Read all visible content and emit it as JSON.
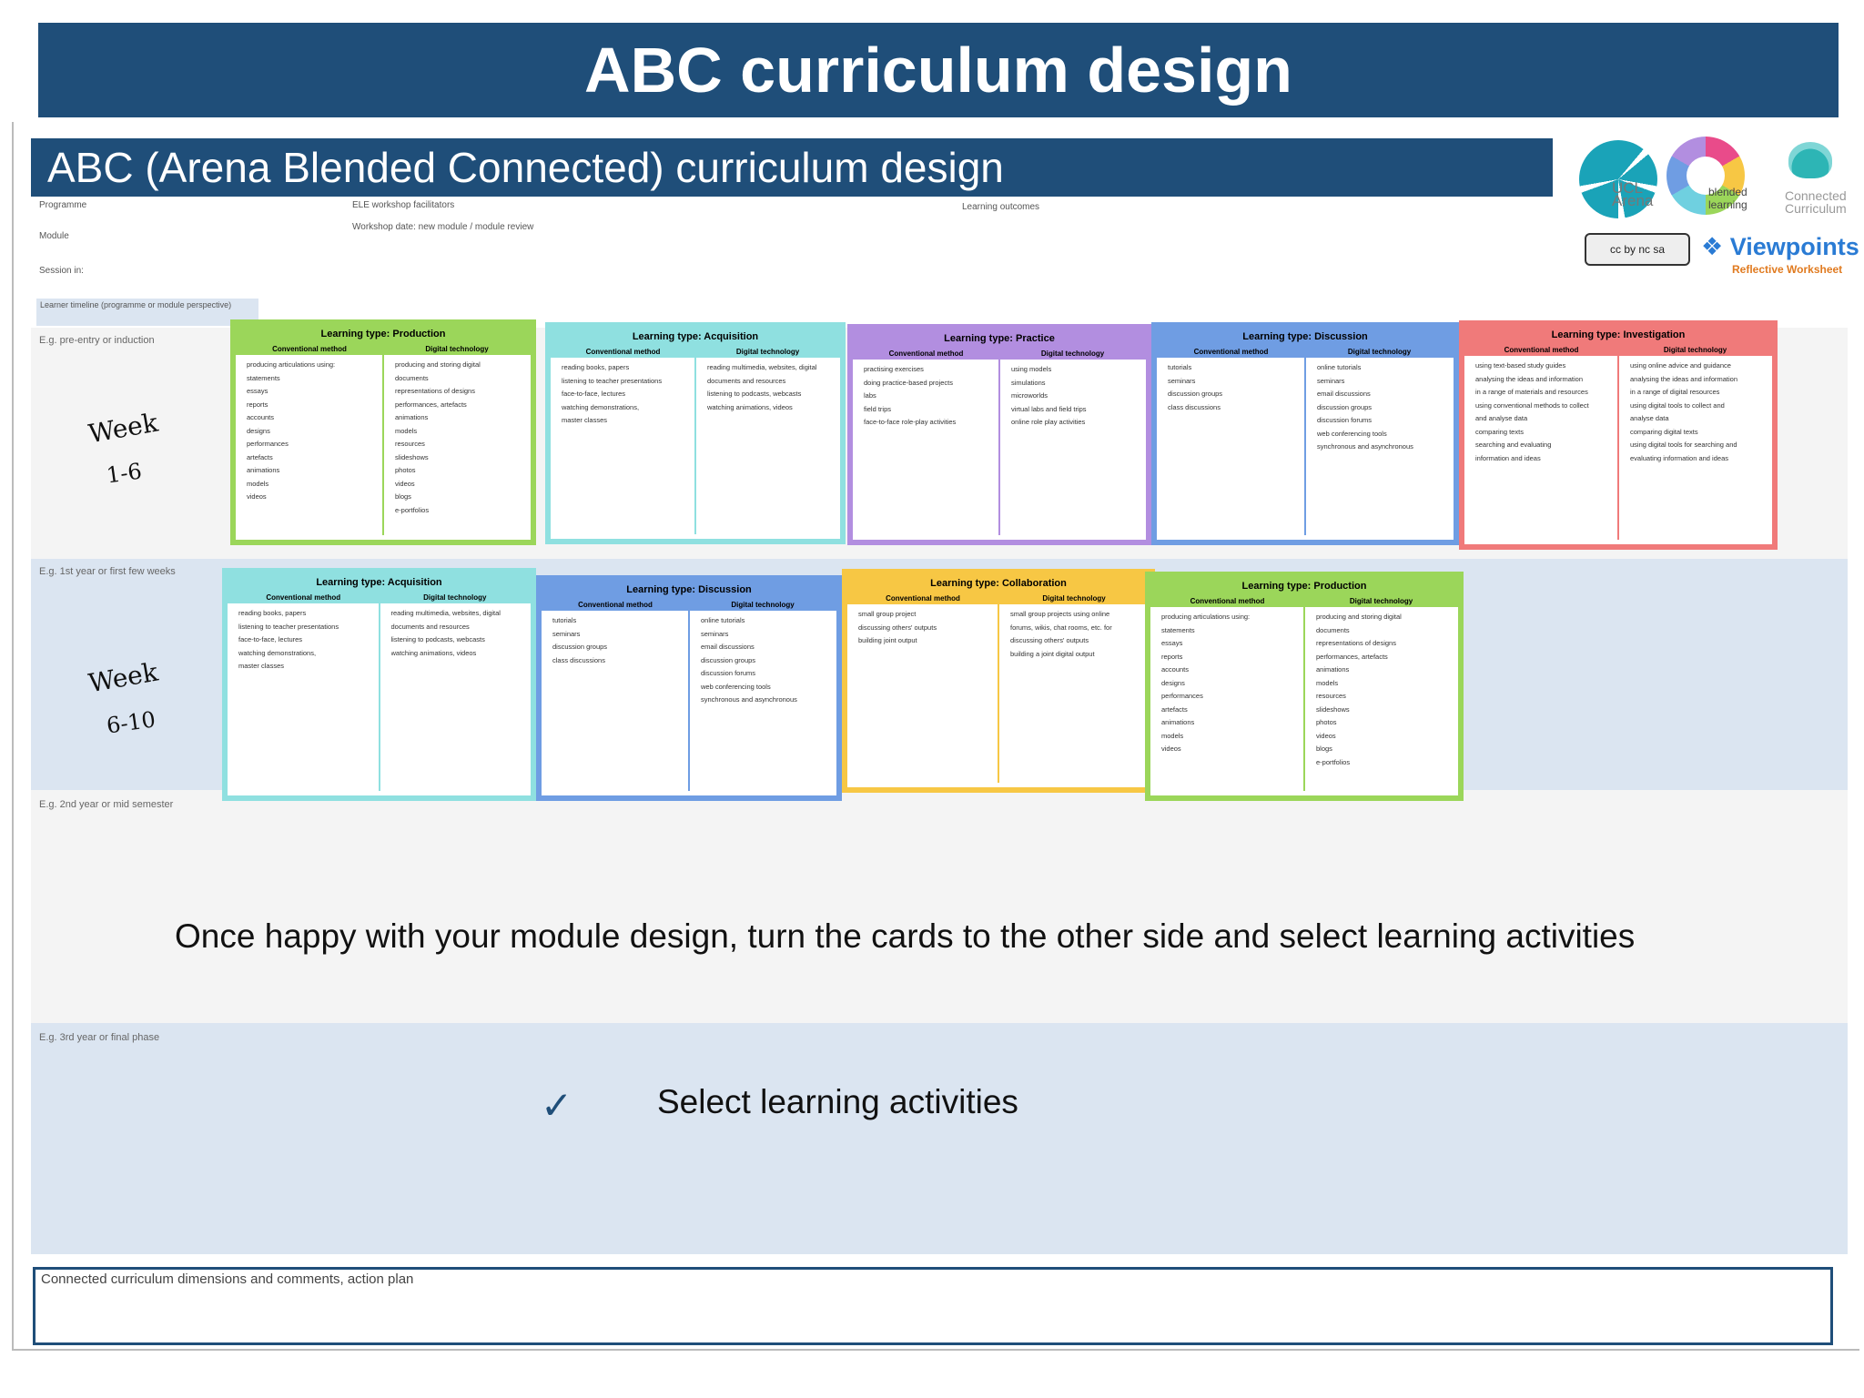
{
  "title": "ABC curriculum design",
  "worksheet": {
    "header": "ABC (Arena Blended Connected) curriculum design",
    "meta": {
      "programme": "Programme",
      "module": "Module",
      "session": "Session in:",
      "facilitators": "ELE workshop facilitators",
      "workshop": "Workshop date: new module / module review",
      "outcomes": "Learning outcomes"
    },
    "timeline_label": "Learner timeline (programme or module perspective)",
    "row_labels": [
      "E.g. pre-entry or induction",
      "E.g. 1st year or first few weeks",
      "E.g. 2nd year or mid semester",
      "E.g. 3rd year or final phase"
    ],
    "weeks": [
      {
        "label": "Week",
        "range": "1-6"
      },
      {
        "label": "Week",
        "range": "6-10"
      }
    ],
    "logos": {
      "ucl": "UCL Arena",
      "blended": "blended learning",
      "connected": "Connected Curriculum",
      "viewpoints": "Viewpoints",
      "viewpoints_sub": "Reflective Worksheet",
      "cc": "cc by nc sa"
    },
    "card_col_headers": {
      "conventional": "Conventional method",
      "digital": "Digital technology"
    },
    "cards_row1": [
      {
        "title": "Learning type: Production",
        "color": "#9bd65a",
        "conventional": [
          "producing articulations using:",
          "statements",
          "essays",
          "reports",
          "accounts",
          "designs",
          "performances",
          "artefacts",
          "animations",
          "models",
          "videos"
        ],
        "digital": [
          "producing and storing digital",
          "documents",
          "representations of designs",
          "performances, artefacts",
          "animations",
          "models",
          "resources",
          "slideshows",
          "photos",
          "videos",
          "blogs",
          "e-portfolios"
        ]
      },
      {
        "title": "Learning type: Acquisition",
        "color": "#8fe0e0",
        "conventional": [
          "reading books, papers",
          "listening to teacher presentations",
          "face-to-face, lectures",
          "watching demonstrations,",
          "master classes"
        ],
        "digital": [
          "reading multimedia, websites, digital",
          "documents and resources",
          "listening to podcasts, webcasts",
          "",
          "watching animations, videos"
        ]
      },
      {
        "title": "Learning type: Practice",
        "color": "#b28ee0",
        "conventional": [
          "practising exercises",
          "doing practice-based projects",
          "labs",
          "field trips",
          "face-to-face role-play activities"
        ],
        "digital": [
          "using models",
          "simulations",
          "microworlds",
          "virtual labs and field trips",
          "online role play activities"
        ]
      },
      {
        "title": "Learning type: Discussion",
        "color": "#6f9de3",
        "conventional": [
          "tutorials",
          "seminars",
          "discussion groups",
          "class discussions"
        ],
        "digital": [
          "online tutorials",
          "seminars",
          "email discussions",
          "discussion groups",
          "discussion forums",
          "web conferencing tools",
          "synchronous and asynchronous"
        ]
      },
      {
        "title": "Learning type: Investigation",
        "color": "#f07a7a",
        "conventional": [
          "using text-based study guides",
          "analysing the ideas and information",
          "in a range of materials and resources",
          "using conventional methods to collect",
          "and analyse data",
          "comparing texts",
          "searching and evaluating",
          "information and ideas"
        ],
        "digital": [
          "using online advice and guidance",
          "analysing the ideas and information",
          "in a range of digital resources",
          "using digital tools to collect and",
          "analyse data",
          "comparing digital texts",
          "using digital tools for searching and",
          "evaluating information and ideas"
        ]
      }
    ],
    "cards_row2": [
      {
        "title": "Learning type: Acquisition",
        "color": "#8fe0e0",
        "conventional": [
          "reading books, papers",
          "listening to teacher presentations",
          "face-to-face, lectures",
          "watching demonstrations,",
          "master classes"
        ],
        "digital": [
          "reading multimedia, websites, digital",
          "documents and resources",
          "listening to podcasts, webcasts",
          "",
          "watching animations, videos"
        ]
      },
      {
        "title": "Learning type: Discussion",
        "color": "#6f9de3",
        "conventional": [
          "tutorials",
          "seminars",
          "discussion groups",
          "class discussions"
        ],
        "digital": [
          "online tutorials",
          "seminars",
          "email discussions",
          "discussion groups",
          "discussion forums",
          "web conferencing tools",
          "synchronous and asynchronous"
        ]
      },
      {
        "title": "Learning type: Collaboration",
        "color": "#f7c744",
        "conventional": [
          "small group project",
          "discussing others' outputs",
          "building joint output"
        ],
        "digital": [
          "small group projects using online",
          "forums, wikis, chat rooms, etc. for",
          "discussing others' outputs",
          "building a joint digital output"
        ]
      },
      {
        "title": "Learning type: Production",
        "color": "#9bd65a",
        "conventional": [
          "producing articulations using:",
          "statements",
          "essays",
          "reports",
          "accounts",
          "designs",
          "performances",
          "artefacts",
          "animations",
          "models",
          "videos"
        ],
        "digital": [
          "producing and storing digital",
          "documents",
          "representations of designs",
          "performances, artefacts",
          "animations",
          "models",
          "resources",
          "slideshows",
          "photos",
          "videos",
          "blogs",
          "e-portfolios"
        ]
      }
    ],
    "instruction": "Once happy with your module design, turn the cards to the other side and select learning activities",
    "checklist": {
      "check": "✓",
      "item": "Select learning activities"
    },
    "comments_label": "Connected curriculum dimensions and comments, action plan"
  }
}
